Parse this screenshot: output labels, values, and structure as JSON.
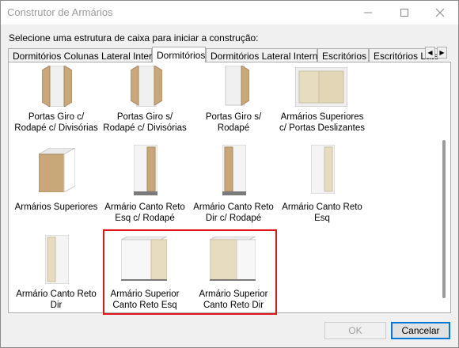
{
  "window": {
    "title": "Construtor de Armários"
  },
  "instruction": "Selecione uma estrutura de caixa para iniciar a construção:",
  "tabs": [
    "Dormitórios Colunas Lateral Interna",
    "Dormitórios",
    "Dormitórios Lateral Interna",
    "Escritórios",
    "Escritórios Lateral"
  ],
  "active_tab": "Dormitórios",
  "items": [
    {
      "line1": "Portas Giro c/",
      "line2": "Rodapé c/ Divisórias",
      "icon": "wardrobe-open-doors-dividers-icon"
    },
    {
      "line1": "Portas Giro s/",
      "line2": "Rodapé c/ Divisórias",
      "icon": "wardrobe-open-doors-icon"
    },
    {
      "line1": "Portas Giro s/",
      "line2": "Rodapé",
      "icon": "wardrobe-open-door-icon"
    },
    {
      "line1": "Armários Superiores",
      "line2": "c/ Portas Deslizantes",
      "icon": "wall-cabinet-sliding-icon"
    },
    {
      "line1": "Armários Superiores",
      "line2": "",
      "icon": "wall-cabinet-icon"
    },
    {
      "line1": "Armário Canto Reto",
      "line2": "Esq c/ Rodapé",
      "icon": "corner-cabinet-left-plinth-icon"
    },
    {
      "line1": "Armário Canto Reto",
      "line2": "Dir c/ Rodapé",
      "icon": "corner-cabinet-right-plinth-icon"
    },
    {
      "line1": "Armário Canto Reto",
      "line2": "Esq",
      "icon": "corner-cabinet-left-icon"
    },
    {
      "line1": "Armário Canto Reto",
      "line2": "Dir",
      "icon": "corner-cabinet-right-icon"
    },
    {
      "line1": "Armário Superior",
      "line2": "Canto Reto Esq",
      "icon": "upper-corner-cabinet-left-icon"
    },
    {
      "line1": "Armário Superior",
      "line2": "Canto Reto Dir",
      "icon": "upper-corner-cabinet-right-icon"
    }
  ],
  "buttons": {
    "ok": "OK",
    "cancel": "Cancelar"
  },
  "colors": {
    "highlight": "#e0141c",
    "wood": "#c9a779",
    "wood_light": "#e8dcc0",
    "white_panel": "#f4f4f4"
  }
}
